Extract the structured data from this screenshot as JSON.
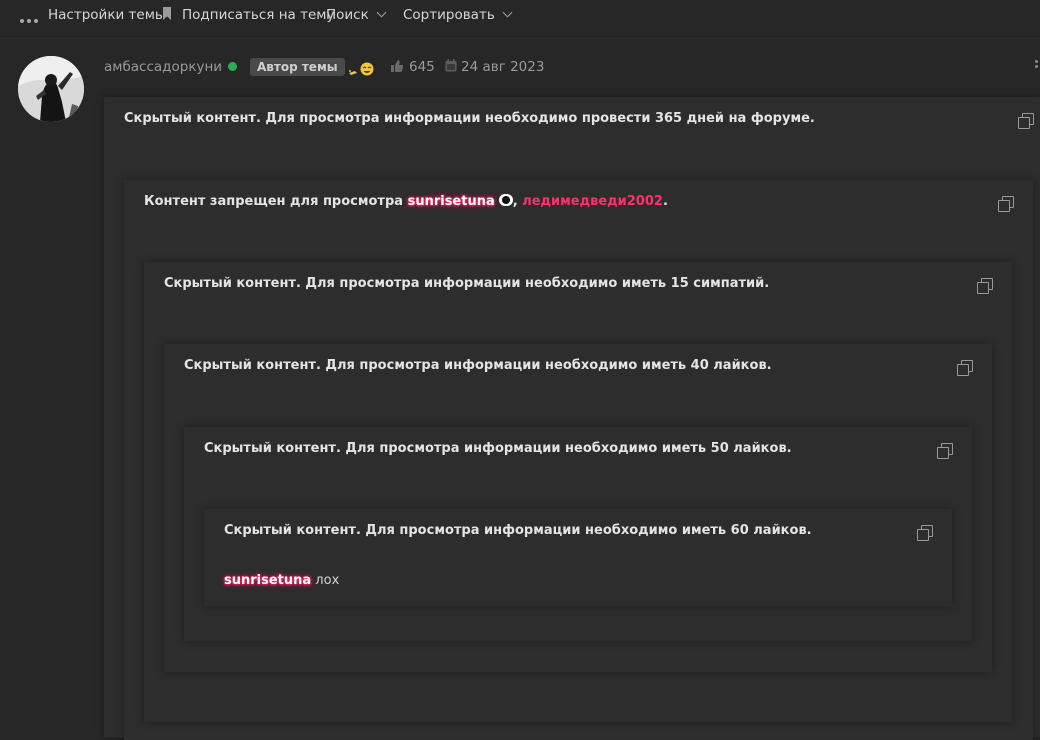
{
  "topbar": {
    "settings_label": "Настройки темы",
    "subscribe_label": "Подписаться на тему",
    "search_label": "Поиск",
    "sort_label": "Сортировать"
  },
  "post": {
    "author": "амбассадоркуни",
    "author_badge": "Автор темы",
    "likes": "645",
    "date": "24 авг 2023"
  },
  "hidden_blocks": [
    {
      "text": "Скрытый контент. Для просмотра информации необходимо провести 365 дней на форуме."
    },
    {
      "text_prefix": "Контент запрещен для просмотра ",
      "user1": "sunrisetuna",
      "separator": ", ",
      "user2": "ледимедведи2002",
      "suffix": "."
    },
    {
      "text": "Скрытый контент. Для просмотра информации необходимо иметь 15 симпатий."
    },
    {
      "text": "Скрытый контент. Для просмотра информации необходимо иметь 40 лайков."
    },
    {
      "text": "Скрытый контент. Для просмотра информации необходимо иметь 50 лайков."
    },
    {
      "text": "Скрытый контент. Для просмотра информации необходимо иметь 60 лайков."
    }
  ],
  "content": {
    "mention": "sunrisetuna",
    "text": " лох"
  },
  "icons": {
    "more": "dots-icon",
    "bookmark": "bookmark-icon",
    "chevron": "chevron-down-icon",
    "like": "thumbs-up-icon",
    "calendar": "calendar-icon",
    "copy": "copy-icon",
    "online": "online-status-icon",
    "post_menu": "kebab-menu-icon"
  },
  "colors": {
    "background": "#272727",
    "block": "#2d2d2d",
    "online": "#2bad56",
    "user_pink": "#ff2a6a",
    "user_red": "#ff2f6e"
  }
}
